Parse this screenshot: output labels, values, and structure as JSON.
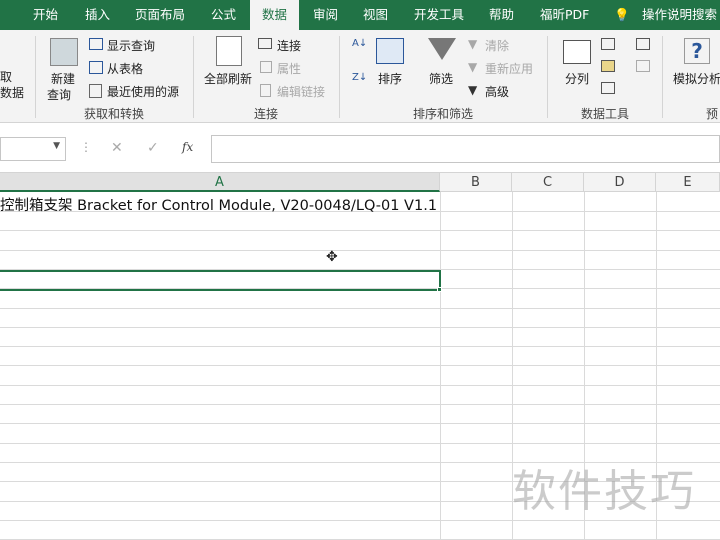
{
  "tabs": [
    "开始",
    "插入",
    "页面布局",
    "公式",
    "数据",
    "审阅",
    "视图",
    "开发工具",
    "帮助",
    "福昕PDF"
  ],
  "active_tab": "数据",
  "tell_me": "操作说明搜索",
  "ribbon": {
    "get_data": [
      "取",
      "数据"
    ],
    "new_query": [
      "新建",
      "查询"
    ],
    "show_queries": "显示查询",
    "from_table": "从表格",
    "recent_sources": "最近使用的源",
    "group_get": "获取和转换",
    "refresh_all": "全部刷新",
    "connections": "连接",
    "properties": "属性",
    "edit_links": "编辑链接",
    "group_conn": "连接",
    "sort": "排序",
    "filter": "筛选",
    "clear": "清除",
    "reapply": "重新应用",
    "advanced": "高级",
    "group_sort": "排序和筛选",
    "text_to_columns": "分列",
    "group_tools": "数据工具",
    "what_if": "模拟分析",
    "group_forecast": "预"
  },
  "formula_bar": {
    "fx": "fx",
    "cancel": "✕",
    "enter": "✓",
    "value": ""
  },
  "columns": [
    "A",
    "B",
    "C",
    "D",
    "E"
  ],
  "cells": {
    "A1": "控制箱支架 Bracket for Control Module, V20-0048/LQ-01 V1.1"
  },
  "watermark": "软件技巧"
}
